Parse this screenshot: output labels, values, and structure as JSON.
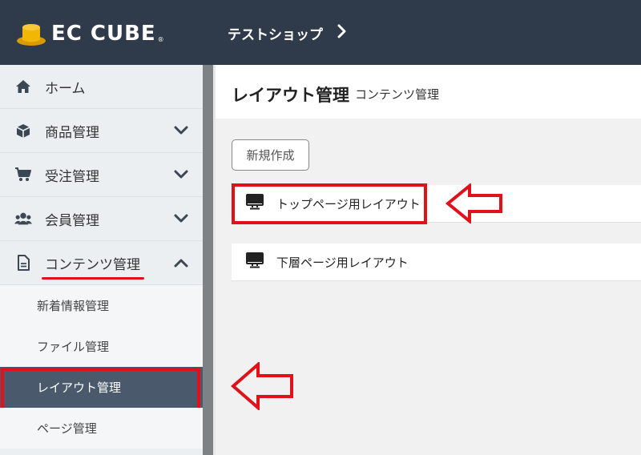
{
  "header": {
    "logo_text": "EC CUBE",
    "logo_reg": "®",
    "shop_name": "テストショップ"
  },
  "sidebar": {
    "items": [
      {
        "label": "ホーム",
        "icon": "home-icon",
        "expandable": false
      },
      {
        "label": "商品管理",
        "icon": "cube-icon",
        "expandable": true,
        "expanded": false
      },
      {
        "label": "受注管理",
        "icon": "cart-icon",
        "expandable": true,
        "expanded": false
      },
      {
        "label": "会員管理",
        "icon": "users-icon",
        "expandable": true,
        "expanded": false
      },
      {
        "label": "コンテンツ管理",
        "icon": "document-icon",
        "expandable": true,
        "expanded": true
      }
    ],
    "sub_items": [
      {
        "label": "新着情報管理",
        "active": false
      },
      {
        "label": "ファイル管理",
        "active": false
      },
      {
        "label": "レイアウト管理",
        "active": true
      },
      {
        "label": "ページ管理",
        "active": false
      }
    ]
  },
  "main": {
    "title": "レイアウト管理",
    "subtitle": "コンテンツ管理",
    "new_button": "新規作成",
    "layouts": [
      {
        "label": "トップページ用レイアウト",
        "icon": "monitor-icon"
      },
      {
        "label": "下層ページ用レイアウト",
        "icon": "monitor-icon"
      }
    ]
  },
  "colors": {
    "header_bg": "#2f3b4a",
    "sidebar_bg": "#eceff1",
    "active_bg": "#4a5a6c",
    "highlight_red": "#e0111b",
    "logo_gold": "#f2b705"
  }
}
